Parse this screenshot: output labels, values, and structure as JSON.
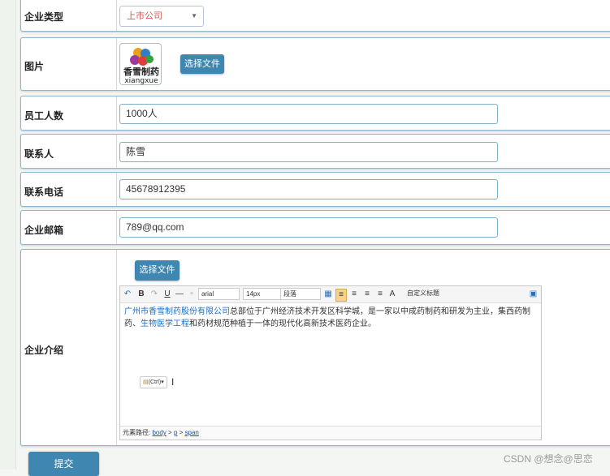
{
  "form": {
    "company_type": {
      "label": "企业类型",
      "value": "上市公司"
    },
    "picture": {
      "label": "图片",
      "logo_text": "香雪制药",
      "logo_sub": "xiangxue",
      "choose_file": "选择文件"
    },
    "employees": {
      "label": "员工人数",
      "value": "1000人"
    },
    "contact": {
      "label": "联系人",
      "value": "陈雪"
    },
    "phone": {
      "label": "联系电话",
      "value": "45678912395"
    },
    "email": {
      "label": "企业邮箱",
      "value": "789@qq.com"
    },
    "intro": {
      "label": "企业介绍",
      "choose_file": "选择文件",
      "toolbar": {
        "bold": "B",
        "underline": "U",
        "font_family": "arial",
        "font_size": "14px",
        "paragraph": "段落",
        "font_color": "A",
        "custom_heading": "自定义标题"
      },
      "content_link1": "广州市香雪制药股份有限公司",
      "content_mid": "总部位于广州经济技术开发区科学城，是一家以中成药制药和研发为主业，集西药制药、",
      "content_link2": "生物医学工程",
      "content_end": "和药材规范种植于一体的现代化高新技术医药企业。",
      "paste_badge": "(Ctrl)",
      "path_label": "元素路径:",
      "path_body": "body",
      "path_p": "p",
      "path_span": "span"
    },
    "submit": "提交"
  },
  "watermark": "CSDN @想念@思恋",
  "colors": {
    "accent": "#3f86b1",
    "select_text": "#d9534f",
    "link": "#1a6fc4"
  }
}
